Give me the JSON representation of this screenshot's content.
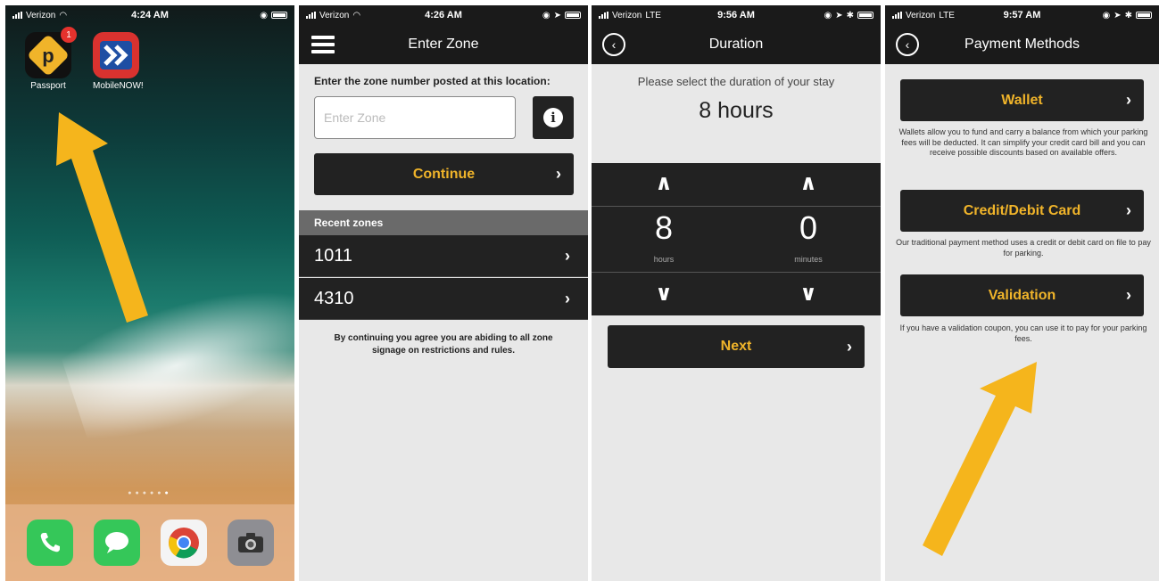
{
  "status_bars": [
    {
      "carrier": "Verizon",
      "network": "",
      "time": "4:24 AM"
    },
    {
      "carrier": "Verizon",
      "network": "",
      "time": "4:26 AM"
    },
    {
      "carrier": "Verizon",
      "network": "LTE",
      "time": "9:56 AM"
    },
    {
      "carrier": "Verizon",
      "network": "LTE",
      "time": "9:57 AM"
    }
  ],
  "home_screen": {
    "apps": [
      {
        "label": "Passport",
        "badge": "1"
      },
      {
        "label": "MobileNOW!"
      }
    ],
    "dock_icons": [
      "phone-icon",
      "messages-icon",
      "chrome-icon",
      "camera-icon"
    ],
    "highlight_color": "#f5b51c"
  },
  "enter_zone": {
    "title": "Enter Zone",
    "instruction": "Enter the zone number posted at this location:",
    "input_placeholder": "Enter Zone",
    "continue_label": "Continue",
    "recent_header": "Recent zones",
    "recent_zones": [
      "1011",
      "4310"
    ],
    "disclaimer": "By continuing you agree you are abiding to all zone signage on restrictions and rules."
  },
  "duration": {
    "title": "Duration",
    "prompt": "Please select the duration of your stay",
    "selected": "8 hours",
    "hours_value": "8",
    "hours_unit": "hours",
    "minutes_value": "0",
    "minutes_unit": "minutes",
    "next_label": "Next"
  },
  "payment_methods": {
    "title": "Payment Methods",
    "options": [
      {
        "label": "Wallet",
        "description": "Wallets allow you to fund and carry a balance from which your parking fees will be deducted. It can simplify your credit card bill and you can receive possible discounts based on available offers."
      },
      {
        "label": "Credit/Debit Card",
        "description": "Our traditional payment method uses a credit or debit card on file to pay for parking."
      },
      {
        "label": "Validation",
        "description": "If you have a validation coupon, you can use it to pay for your parking fees."
      }
    ]
  },
  "colors": {
    "accent": "#f0b42a",
    "dark": "#222222",
    "arrow": "#f5b51c"
  }
}
